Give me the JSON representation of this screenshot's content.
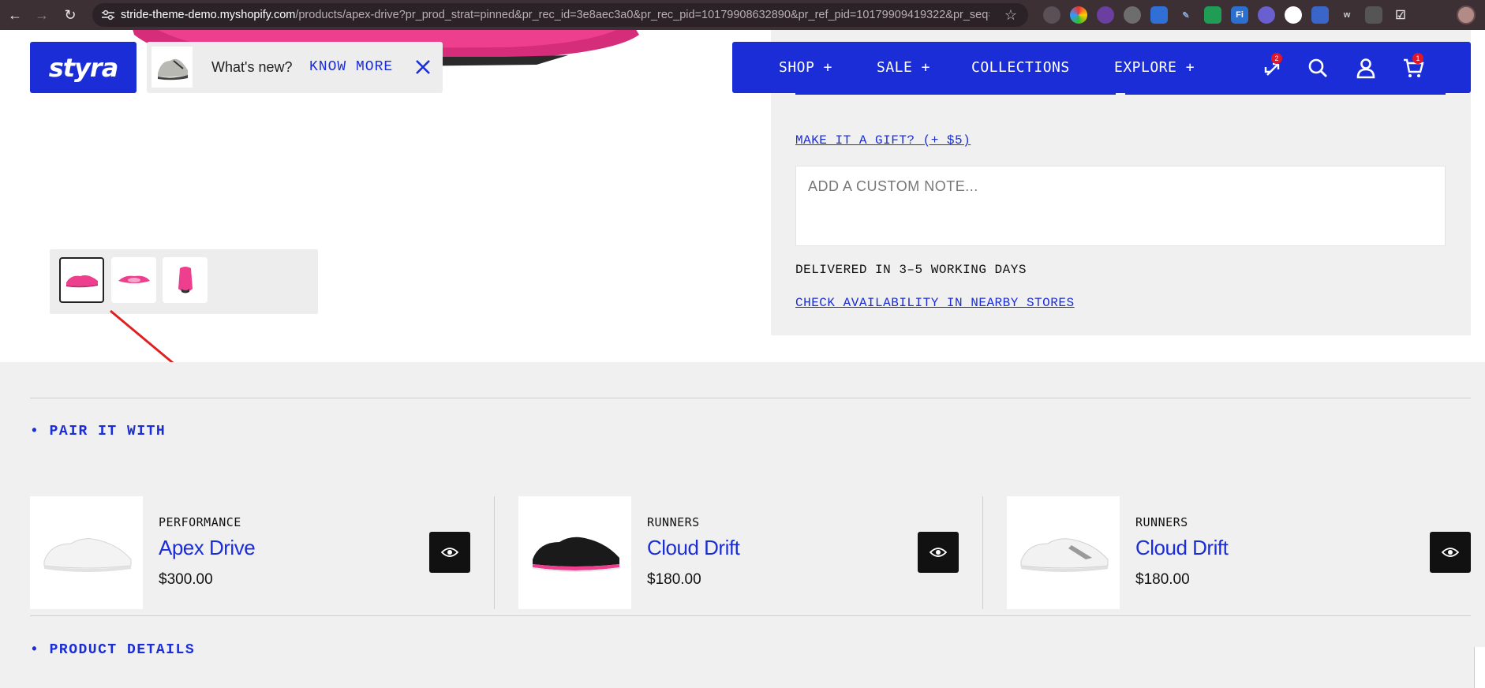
{
  "browser": {
    "url_host": "stride-theme-demo.myshopify.com",
    "url_path": "/products/apex-drive?pr_prod_strat=pinned&pr_rec_id=3e8aec3a0&pr_rec_pid=10179908632890&pr_ref_pid=10179909419322&pr_seq=unifo..."
  },
  "header": {
    "logo": "styra",
    "whats_new": {
      "label": "What's new?",
      "link": "KNOW MORE"
    },
    "nav": [
      {
        "label": "SHOP +"
      },
      {
        "label": "SALE +"
      },
      {
        "label": "COLLECTIONS"
      },
      {
        "label": "EXPLORE +"
      }
    ],
    "compare_count": "2",
    "cart_count": "1"
  },
  "product_panel": {
    "gift_link": "MAKE IT A GIFT? (+ $5)",
    "note_placeholder": "ADD A CUSTOM NOTE...",
    "delivery": "DELIVERED IN 3–5 WORKING DAYS",
    "stores_link": "CHECK AVAILABILITY IN NEARBY STORES"
  },
  "pair_section": {
    "title": "• PAIR IT WITH",
    "items": [
      {
        "category": "PERFORMANCE",
        "name": "Apex Drive",
        "price": "$300.00"
      },
      {
        "category": "RUNNERS",
        "name": "Cloud Drift",
        "price": "$180.00"
      },
      {
        "category": "RUNNERS",
        "name": "Cloud Drift",
        "price": "$180.00"
      }
    ]
  },
  "details_section": {
    "title": "• PRODUCT DETAILS"
  },
  "colors": {
    "brand": "#1a2dd6",
    "accent_pink": "#ee3f8f",
    "badge_red": "#e0162b"
  }
}
